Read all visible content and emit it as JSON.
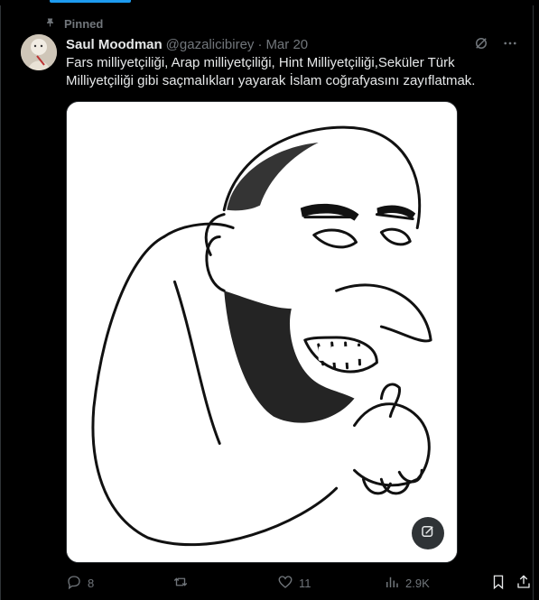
{
  "pinned_label": "Pinned",
  "author": {
    "name": "Saul Moodman",
    "handle": "@gazalicibirey",
    "separator": "·",
    "date": "Mar 20"
  },
  "tweet": {
    "text": "Fars milliyetçiliği, Arap milliyetçiliği, Hint Milliyetçiliği,Seküler Türk Milliyetçiliği gibi saçmalıkları yayarak İslam coğrafyasını zayıflatmak."
  },
  "actions": {
    "replies": "8",
    "likes": "11",
    "views": "2.9K"
  },
  "icons": {
    "pin": "pin-icon",
    "grok": "grok-icon",
    "more": "more-icon",
    "reply": "reply-icon",
    "retweet": "retweet-icon",
    "like": "like-icon",
    "views": "views-icon",
    "bookmark": "bookmark-icon",
    "share": "share-icon",
    "alt": "edit-image-icon"
  },
  "colors": {
    "background": "#000000",
    "text": "#e7e9ea",
    "muted": "#71767b",
    "accent": "#1d9bf0"
  }
}
